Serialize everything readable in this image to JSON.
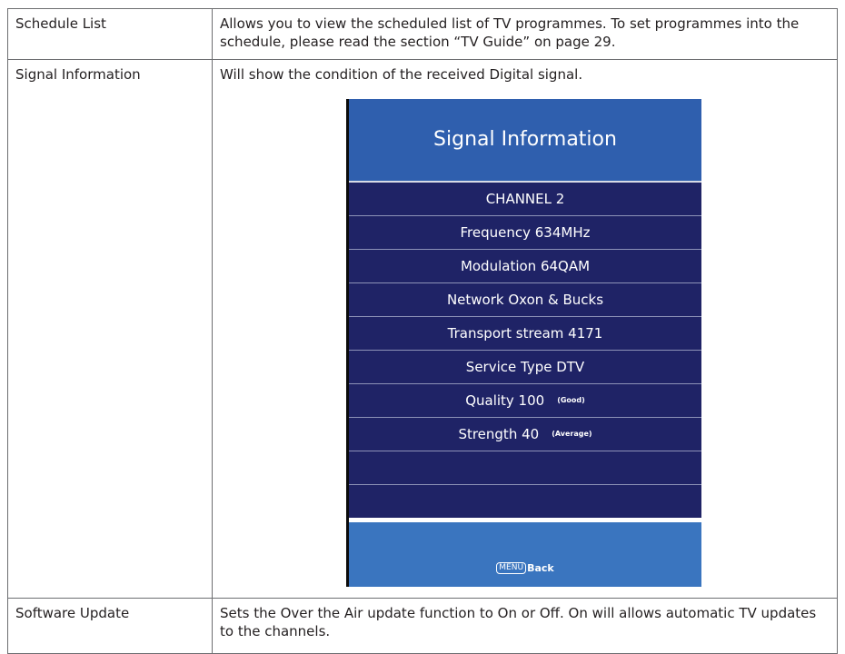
{
  "rows": [
    {
      "label": "Schedule List",
      "description": "Allows you to view the scheduled list of TV programmes. To set programmes into the schedule, please read the section “TV Guide” on page 29."
    },
    {
      "label": "Signal Information",
      "description": "Will show the condition of the received Digital signal."
    },
    {
      "label": "Software Update",
      "description": "Sets the Over the Air update function to On or Off. On will allows automatic TV updates to the channels."
    }
  ],
  "tv_screen": {
    "title": "Signal Information",
    "items": [
      {
        "text": "CHANNEL  2",
        "note": ""
      },
      {
        "text": "Frequency 634MHz",
        "note": ""
      },
      {
        "text": "Modulation 64QAM",
        "note": ""
      },
      {
        "text": "Network Oxon & Bucks",
        "note": ""
      },
      {
        "text": "Transport stream 4171",
        "note": ""
      },
      {
        "text": "Service Type DTV",
        "note": ""
      },
      {
        "text": "Quality 100",
        "note": "(Good)"
      },
      {
        "text": "Strength 40",
        "note": "(Average)"
      },
      {
        "text": "",
        "note": ""
      },
      {
        "text": "",
        "note": ""
      }
    ],
    "footer": {
      "key": "MENU",
      "label": "Back"
    },
    "colors": {
      "header": "#2f5fae",
      "rows": "#1f2366",
      "footer": "#3a75bf",
      "text": "#ffffff"
    }
  }
}
